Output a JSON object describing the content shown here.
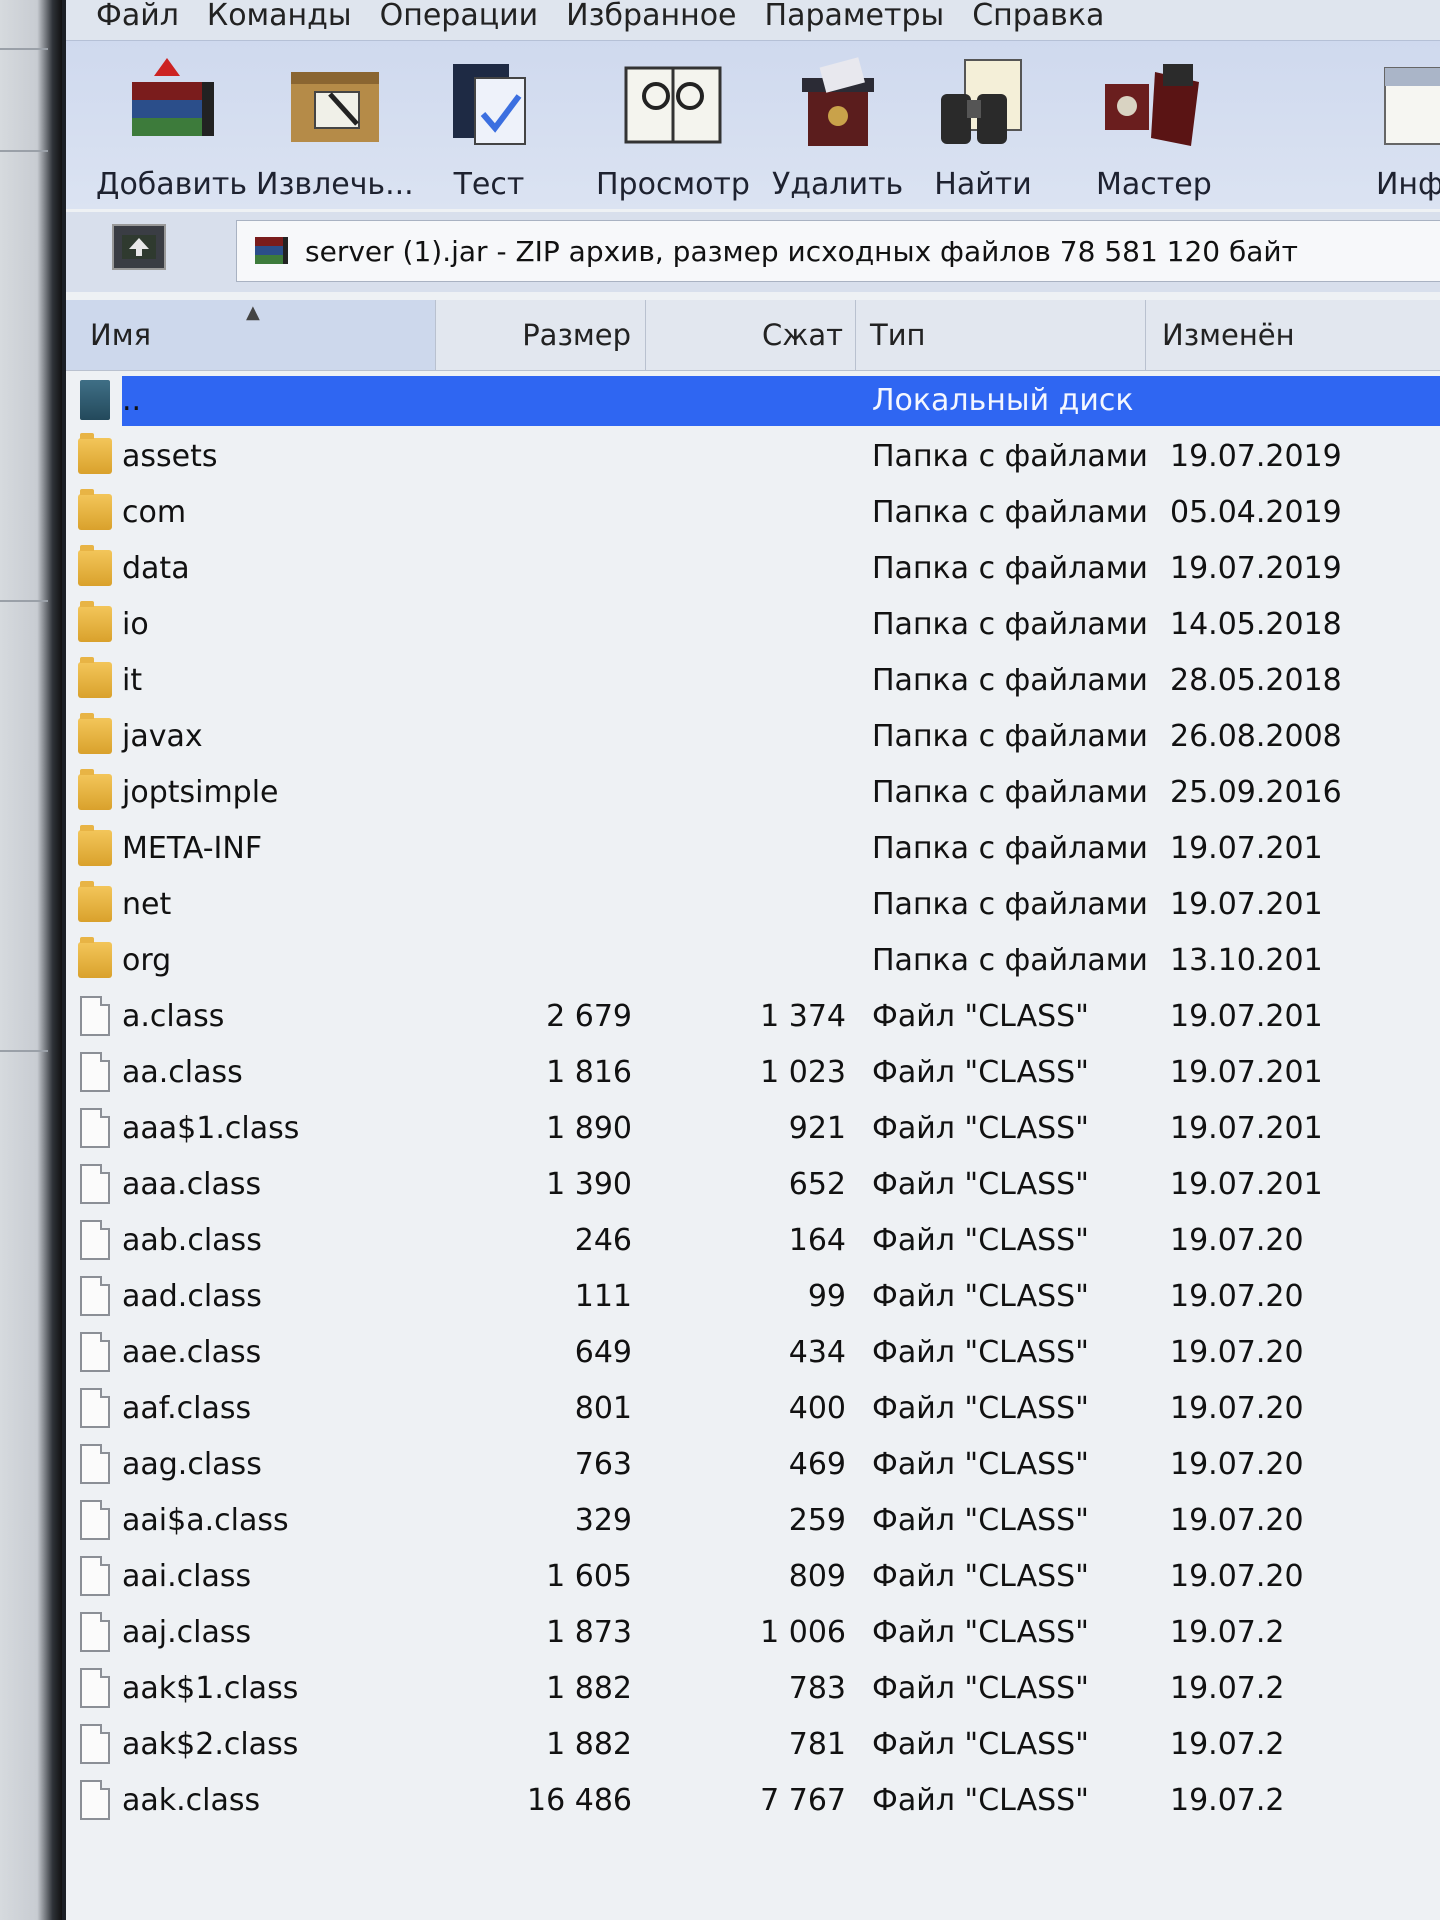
{
  "menu": [
    "Файл",
    "Команды",
    "Операции",
    "Избранное",
    "Параметры",
    "Справка"
  ],
  "toolbar": [
    {
      "label": "Добавить",
      "icon": "add-archive-icon"
    },
    {
      "label": "Извлечь...",
      "icon": "extract-icon"
    },
    {
      "label": "Тест",
      "icon": "test-icon"
    },
    {
      "label": "Просмотр",
      "icon": "view-icon"
    },
    {
      "label": "Удалить",
      "icon": "delete-icon"
    },
    {
      "label": "Найти",
      "icon": "find-icon"
    },
    {
      "label": "Мастер",
      "icon": "wizard-icon"
    },
    {
      "label": "Инфо",
      "icon": "info-icon"
    }
  ],
  "address": "server (1).jar - ZIP архив, размер исходных файлов 78 581 120 байт",
  "columns": {
    "name": "Имя",
    "size": "Размер",
    "packed": "Сжат",
    "type": "Тип",
    "modified": "Изменён"
  },
  "rows": [
    {
      "kind": "up",
      "name": "..",
      "size": "",
      "packed": "",
      "type": "Локальный диск",
      "modified": ""
    },
    {
      "kind": "folder",
      "name": "assets",
      "size": "",
      "packed": "",
      "type": "Папка с файлами",
      "modified": "19.07.2019"
    },
    {
      "kind": "folder",
      "name": "com",
      "size": "",
      "packed": "",
      "type": "Папка с файлами",
      "modified": "05.04.2019"
    },
    {
      "kind": "folder",
      "name": "data",
      "size": "",
      "packed": "",
      "type": "Папка с файлами",
      "modified": "19.07.2019"
    },
    {
      "kind": "folder",
      "name": "io",
      "size": "",
      "packed": "",
      "type": "Папка с файлами",
      "modified": "14.05.2018"
    },
    {
      "kind": "folder",
      "name": "it",
      "size": "",
      "packed": "",
      "type": "Папка с файлами",
      "modified": "28.05.2018"
    },
    {
      "kind": "folder",
      "name": "javax",
      "size": "",
      "packed": "",
      "type": "Папка с файлами",
      "modified": "26.08.2008"
    },
    {
      "kind": "folder",
      "name": "joptsimple",
      "size": "",
      "packed": "",
      "type": "Папка с файлами",
      "modified": "25.09.2016"
    },
    {
      "kind": "folder",
      "name": "META-INF",
      "size": "",
      "packed": "",
      "type": "Папка с файлами",
      "modified": "19.07.201"
    },
    {
      "kind": "folder",
      "name": "net",
      "size": "",
      "packed": "",
      "type": "Папка с файлами",
      "modified": "19.07.201"
    },
    {
      "kind": "folder",
      "name": "org",
      "size": "",
      "packed": "",
      "type": "Папка с файлами",
      "modified": "13.10.201"
    },
    {
      "kind": "file",
      "name": "a.class",
      "size": "2 679",
      "packed": "1 374",
      "type": "Файл \"CLASS\"",
      "modified": "19.07.201"
    },
    {
      "kind": "file",
      "name": "aa.class",
      "size": "1 816",
      "packed": "1 023",
      "type": "Файл \"CLASS\"",
      "modified": "19.07.201"
    },
    {
      "kind": "file",
      "name": "aaa$1.class",
      "size": "1 890",
      "packed": "921",
      "type": "Файл \"CLASS\"",
      "modified": "19.07.201"
    },
    {
      "kind": "file",
      "name": "aaa.class",
      "size": "1 390",
      "packed": "652",
      "type": "Файл \"CLASS\"",
      "modified": "19.07.201"
    },
    {
      "kind": "file",
      "name": "aab.class",
      "size": "246",
      "packed": "164",
      "type": "Файл \"CLASS\"",
      "modified": "19.07.20"
    },
    {
      "kind": "file",
      "name": "aad.class",
      "size": "111",
      "packed": "99",
      "type": "Файл \"CLASS\"",
      "modified": "19.07.20"
    },
    {
      "kind": "file",
      "name": "aae.class",
      "size": "649",
      "packed": "434",
      "type": "Файл \"CLASS\"",
      "modified": "19.07.20"
    },
    {
      "kind": "file",
      "name": "aaf.class",
      "size": "801",
      "packed": "400",
      "type": "Файл \"CLASS\"",
      "modified": "19.07.20"
    },
    {
      "kind": "file",
      "name": "aag.class",
      "size": "763",
      "packed": "469",
      "type": "Файл \"CLASS\"",
      "modified": "19.07.20"
    },
    {
      "kind": "file",
      "name": "aai$a.class",
      "size": "329",
      "packed": "259",
      "type": "Файл \"CLASS\"",
      "modified": "19.07.20"
    },
    {
      "kind": "file",
      "name": "aai.class",
      "size": "1 605",
      "packed": "809",
      "type": "Файл \"CLASS\"",
      "modified": "19.07.20"
    },
    {
      "kind": "file",
      "name": "aaj.class",
      "size": "1 873",
      "packed": "1 006",
      "type": "Файл \"CLASS\"",
      "modified": "19.07.2"
    },
    {
      "kind": "file",
      "name": "aak$1.class",
      "size": "1 882",
      "packed": "783",
      "type": "Файл \"CLASS\"",
      "modified": "19.07.2"
    },
    {
      "kind": "file",
      "name": "aak$2.class",
      "size": "1 882",
      "packed": "781",
      "type": "Файл \"CLASS\"",
      "modified": "19.07.2"
    },
    {
      "kind": "file",
      "name": "aak.class",
      "size": "16 486",
      "packed": "7 767",
      "type": "Файл \"CLASS\"",
      "modified": "19.07.2"
    }
  ],
  "selected_row": 0,
  "colors": {
    "selection": "#2f66f2",
    "toolbar": "#d3dcef"
  }
}
